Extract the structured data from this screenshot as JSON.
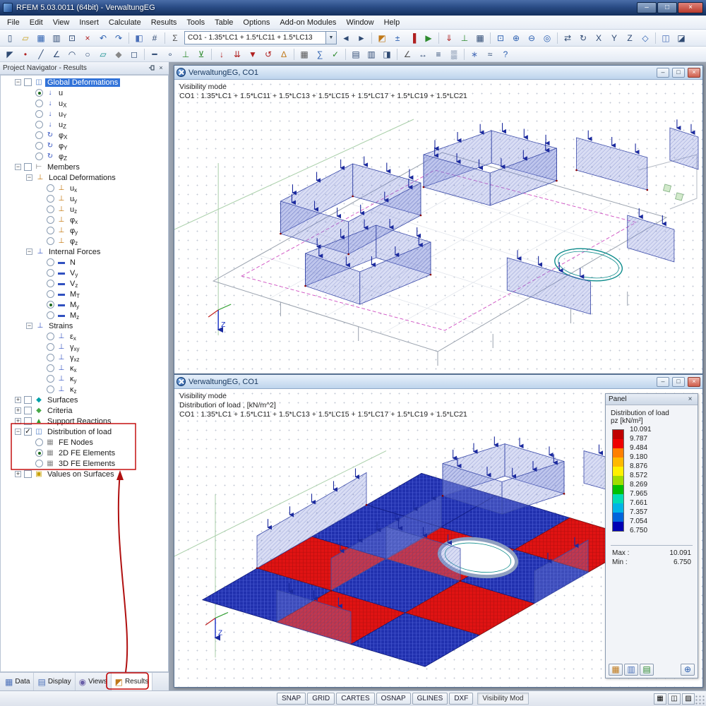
{
  "window": {
    "title": "RFEM 5.03.0011 (64bit) - VerwaltungEG"
  },
  "window_controls": {
    "min": "–",
    "max": "□",
    "close": "×"
  },
  "glyphs": {
    "check": "✓",
    "expander_open": "−",
    "expander_closed": "+",
    "combo_arrow": "▼",
    "z_axis": "Z"
  },
  "menu": [
    "File",
    "Edit",
    "View",
    "Insert",
    "Calculate",
    "Results",
    "Tools",
    "Table",
    "Options",
    "Add-on Modules",
    "Window",
    "Help"
  ],
  "toolbar_main": {
    "left_icons": [
      {
        "n": "new-file",
        "g": "▯"
      },
      {
        "n": "open-file",
        "g": "▱",
        "c": "#c8a020"
      },
      {
        "n": "save",
        "g": "▦",
        "c": "#2b5fb0"
      },
      {
        "n": "print",
        "g": "▥"
      },
      {
        "n": "copy",
        "g": "⊡"
      },
      {
        "n": "delete",
        "g": "×",
        "c": "#b02020"
      },
      {
        "n": "undo",
        "g": "↶",
        "c": "#2b5fb0"
      },
      {
        "n": "redo",
        "g": "↷",
        "c": "#2b5fb0"
      },
      {
        "sep": true
      },
      {
        "n": "render-model",
        "g": "◧",
        "c": "#4a6fb8"
      },
      {
        "n": "show-numbering",
        "g": "#"
      },
      {
        "sep": true
      },
      {
        "n": "load-case-list",
        "g": "Σ",
        "c": "#555"
      }
    ],
    "combo_value": "CO1 - 1.35*LC1 + 1.5*LC11 + 1.5*LC13",
    "right_icons": [
      {
        "n": "previous-load-case",
        "g": "◄"
      },
      {
        "n": "next-load-case",
        "g": "►"
      },
      {
        "sep": true
      },
      {
        "n": "show-results",
        "g": "◩",
        "c": "#c07818"
      },
      {
        "n": "show-result-values",
        "g": "±",
        "c": "#2b5fb0"
      },
      {
        "n": "result-panel-toggle",
        "g": "▐",
        "c": "#b02020"
      },
      {
        "n": "animation",
        "g": "▶",
        "c": "#2e8b2e"
      },
      {
        "sep": true
      },
      {
        "n": "show-loads",
        "g": "⇓",
        "c": "#b02020"
      },
      {
        "n": "show-supports",
        "g": "⊥",
        "c": "#2e8b2e"
      },
      {
        "n": "show-fe-mesh",
        "g": "▦"
      },
      {
        "sep": true
      },
      {
        "n": "zoom-window",
        "g": "⊡",
        "c": "#2b5fb0"
      },
      {
        "n": "zoom-in",
        "g": "⊕",
        "c": "#2b5fb0"
      },
      {
        "n": "zoom-out",
        "g": "⊖",
        "c": "#2b5fb0"
      },
      {
        "n": "zoom-all",
        "g": "◎",
        "c": "#2b5fb0"
      },
      {
        "sep": true
      },
      {
        "n": "pan-view",
        "g": "⇄"
      },
      {
        "n": "rotate-view",
        "g": "↻"
      },
      {
        "n": "view-x",
        "g": "X"
      },
      {
        "n": "view-y",
        "g": "Y"
      },
      {
        "n": "view-z",
        "g": "Z"
      },
      {
        "n": "isometric-view",
        "g": "◇",
        "c": "#2b5fb0"
      },
      {
        "sep": true
      },
      {
        "n": "visibility-mode",
        "g": "◫",
        "c": "#4a6fb8"
      },
      {
        "n": "clipping-plane",
        "g": "◪"
      }
    ]
  },
  "toolbar_edit": {
    "icons": [
      {
        "n": "edit-pointer",
        "g": "◤"
      },
      {
        "n": "insert-node",
        "g": "•",
        "c": "#b02020"
      },
      {
        "n": "insert-line",
        "g": "╱"
      },
      {
        "n": "insert-polyline",
        "g": "∠"
      },
      {
        "n": "insert-arc",
        "g": "◠"
      },
      {
        "n": "insert-circle",
        "g": "○"
      },
      {
        "n": "insert-surface",
        "g": "▱",
        "c": "#0a8a8a"
      },
      {
        "n": "insert-solid",
        "g": "◆",
        "c": "#888888"
      },
      {
        "n": "insert-opening",
        "g": "◻"
      },
      {
        "sep": true
      },
      {
        "n": "insert-member",
        "g": "━"
      },
      {
        "n": "member-hinge",
        "g": "∘"
      },
      {
        "n": "nodal-support",
        "g": "⊥",
        "c": "#2e8b2e"
      },
      {
        "n": "line-support",
        "g": "⊻",
        "c": "#2e8b2e"
      },
      {
        "sep": true
      },
      {
        "n": "nodal-load",
        "g": "↓",
        "c": "#b02020"
      },
      {
        "n": "line-load",
        "g": "⇊",
        "c": "#b02020"
      },
      {
        "n": "surface-load",
        "g": "▼",
        "c": "#b02020"
      },
      {
        "n": "moment-load",
        "g": "↺",
        "c": "#b02020"
      },
      {
        "n": "temperature-load",
        "g": "∆",
        "c": "#c07818"
      },
      {
        "sep": true
      },
      {
        "n": "generate-mesh",
        "g": "▦",
        "c": "#555555"
      },
      {
        "n": "calculate-all",
        "g": "∑",
        "c": "#2b5fb0"
      },
      {
        "n": "check-model",
        "g": "✓",
        "c": "#2e8b2e"
      },
      {
        "sep": true
      },
      {
        "n": "result-tables",
        "g": "▤"
      },
      {
        "n": "printout-report",
        "g": "▥"
      },
      {
        "n": "panel-options",
        "g": "◨"
      },
      {
        "sep": true
      },
      {
        "n": "measure",
        "g": "∠",
        "c": "#555555"
      },
      {
        "n": "dimension",
        "g": "↔"
      },
      {
        "n": "layers",
        "g": "≡"
      },
      {
        "n": "background-grid",
        "g": "▒"
      },
      {
        "sep": true
      },
      {
        "n": "add-on-modules",
        "g": "∗",
        "c": "#4a6fb8"
      },
      {
        "n": "settings",
        "g": "≈"
      },
      {
        "n": "help",
        "g": "?",
        "c": "#2b5fb0"
      }
    ]
  },
  "navigator": {
    "title": "Project Navigator - Results",
    "tabs": [
      {
        "label": "Data",
        "icon": "data-tab-icon",
        "g": "▦",
        "c": "#4a6fb8"
      },
      {
        "label": "Display",
        "icon": "display-tab-icon",
        "g": "▤",
        "c": "#4a6fb8"
      },
      {
        "label": "Views",
        "icon": "views-tab-icon",
        "g": "◉",
        "c": "#6a5fa8"
      },
      {
        "label": "Results",
        "icon": "results-tab-icon",
        "g": "◩",
        "c": "#c07818",
        "active": true
      }
    ],
    "tree": [
      {
        "label": "Global Deformations",
        "level": 0,
        "exp": "minus",
        "ctrl": "check",
        "checked": false,
        "icon": "global-deformations",
        "g": "◫",
        "c": "#4a7ac8",
        "selected": true
      },
      {
        "label": "u",
        "level": 1,
        "ctrl": "radio",
        "checked": true,
        "icon": "deformation-u",
        "g": "↓",
        "c": "#3050c0"
      },
      {
        "label": "u",
        "sub": "X",
        "level": 1,
        "ctrl": "radio",
        "checked": false,
        "icon": "deformation-ux",
        "g": "↓",
        "c": "#3050c0"
      },
      {
        "label": "u",
        "sub": "Y",
        "level": 1,
        "ctrl": "radio",
        "checked": false,
        "icon": "deformation-uy",
        "g": "↓",
        "c": "#3050c0"
      },
      {
        "label": "u",
        "sub": "Z",
        "level": 1,
        "ctrl": "radio",
        "checked": false,
        "icon": "deformation-uz",
        "g": "↓",
        "c": "#3050c0"
      },
      {
        "label": "φ",
        "sub": "X",
        "level": 1,
        "ctrl": "radio",
        "checked": false,
        "icon": "rotation-phix",
        "g": "↻",
        "c": "#3050c0"
      },
      {
        "label": "φ",
        "sub": "Y",
        "level": 1,
        "ctrl": "radio",
        "checked": false,
        "icon": "rotation-phiy",
        "g": "↻",
        "c": "#3050c0"
      },
      {
        "label": "φ",
        "sub": "Z",
        "level": 1,
        "ctrl": "radio",
        "checked": false,
        "icon": "rotation-phiz",
        "g": "↻",
        "c": "#3050c0"
      },
      {
        "label": "Members",
        "level": 0,
        "exp": "minus",
        "ctrl": "check",
        "checked": false,
        "icon": "members",
        "g": "⊢",
        "c": "#707070"
      },
      {
        "label": "Local Deformations",
        "level": 1,
        "exp": "minus",
        "icon": "local-deformations",
        "g": "⊥",
        "c": "#c07000"
      },
      {
        "label": "u",
        "sub": "x",
        "level": 2,
        "ctrl": "radio",
        "checked": false,
        "icon": "member-ux",
        "g": "⊥",
        "c": "#c07000"
      },
      {
        "label": "u",
        "sub": "y",
        "level": 2,
        "ctrl": "radio",
        "checked": false,
        "icon": "member-uy",
        "g": "⊥",
        "c": "#c07000"
      },
      {
        "label": "u",
        "sub": "z",
        "level": 2,
        "ctrl": "radio",
        "checked": false,
        "icon": "member-uz",
        "g": "⊥",
        "c": "#c07000"
      },
      {
        "label": "φ",
        "sub": "x",
        "level": 2,
        "ctrl": "radio",
        "checked": false,
        "icon": "member-phix",
        "g": "⊥",
        "c": "#c07000"
      },
      {
        "label": "φ",
        "sub": "y",
        "level": 2,
        "ctrl": "radio",
        "checked": false,
        "icon": "member-phiy",
        "g": "⊥",
        "c": "#c07000"
      },
      {
        "label": "φ",
        "sub": "z",
        "level": 2,
        "ctrl": "radio",
        "checked": false,
        "icon": "member-phiz",
        "g": "⊥",
        "c": "#c07000"
      },
      {
        "label": "Internal Forces",
        "level": 1,
        "exp": "minus",
        "icon": "internal-forces",
        "g": "⊥",
        "c": "#3050c0"
      },
      {
        "label": "N",
        "level": 2,
        "ctrl": "radio",
        "checked": false,
        "icon": "force-n",
        "g": "▬",
        "c": "#3050c0"
      },
      {
        "label": "V",
        "sub": "y",
        "level": 2,
        "ctrl": "radio",
        "checked": false,
        "icon": "force-vy",
        "g": "▬",
        "c": "#3050c0"
      },
      {
        "label": "V",
        "sub": "z",
        "level": 2,
        "ctrl": "radio",
        "checked": false,
        "icon": "force-vz",
        "g": "▬",
        "c": "#3050c0"
      },
      {
        "label": "M",
        "sub": "T",
        "level": 2,
        "ctrl": "radio",
        "checked": false,
        "icon": "moment-mt",
        "g": "▬",
        "c": "#3050c0"
      },
      {
        "label": "M",
        "sub": "y",
        "level": 2,
        "ctrl": "radio",
        "checked": true,
        "icon": "moment-my",
        "g": "▬",
        "c": "#3050c0"
      },
      {
        "label": "M",
        "sub": "z",
        "level": 2,
        "ctrl": "radio",
        "checked": false,
        "icon": "moment-mz",
        "g": "▬",
        "c": "#3050c0"
      },
      {
        "label": "Strains",
        "level": 1,
        "exp": "minus",
        "icon": "strains",
        "g": "⊥",
        "c": "#3050c0"
      },
      {
        "label": "ε",
        "sub": "x",
        "level": 2,
        "ctrl": "radio",
        "checked": false,
        "icon": "strain-ex",
        "g": "⊥",
        "c": "#3050c0"
      },
      {
        "label": "γ",
        "sub": "xy",
        "level": 2,
        "ctrl": "radio",
        "checked": false,
        "icon": "strain-gxy",
        "g": "⊥",
        "c": "#3050c0"
      },
      {
        "label": "γ",
        "sub": "xz",
        "level": 2,
        "ctrl": "radio",
        "checked": false,
        "icon": "strain-gxz",
        "g": "⊥",
        "c": "#3050c0"
      },
      {
        "label": "κ",
        "sub": "x",
        "level": 2,
        "ctrl": "radio",
        "checked": false,
        "icon": "strain-kx",
        "g": "⊥",
        "c": "#3050c0"
      },
      {
        "label": "κ",
        "sub": "y",
        "level": 2,
        "ctrl": "radio",
        "checked": false,
        "icon": "strain-ky",
        "g": "⊥",
        "c": "#3050c0"
      },
      {
        "label": "κ",
        "sub": "z",
        "level": 2,
        "ctrl": "radio",
        "checked": false,
        "icon": "strain-kz",
        "g": "⊥",
        "c": "#3050c0"
      },
      {
        "label": "Surfaces",
        "level": 0,
        "exp": "plus",
        "ctrl": "check",
        "checked": false,
        "icon": "surfaces",
        "g": "◆",
        "c": "#00a0a8"
      },
      {
        "label": "Criteria",
        "level": 0,
        "exp": "plus",
        "ctrl": "check",
        "checked": false,
        "icon": "criteria",
        "g": "◆",
        "c": "#46a846"
      },
      {
        "label": "Support Reactions",
        "level": 0,
        "exp": "plus",
        "ctrl": "check",
        "checked": false,
        "icon": "support-reactions",
        "g": "▲",
        "c": "#2e9e2e"
      },
      {
        "label": "Distribution of load",
        "level": 0,
        "exp": "minus",
        "ctrl": "check",
        "checked": true,
        "icon": "distribution-of-load",
        "g": "◫",
        "c": "#4a7ac8"
      },
      {
        "label": "FE Nodes",
        "level": 1,
        "ctrl": "radio",
        "checked": false,
        "icon": "fe-nodes",
        "g": "▦",
        "c": "#888888"
      },
      {
        "label": "2D FE Elements",
        "level": 1,
        "ctrl": "radio",
        "checked": true,
        "icon": "fe-elements-2d",
        "g": "▦",
        "c": "#888888"
      },
      {
        "label": "3D FE Elements",
        "level": 1,
        "ctrl": "radio",
        "checked": false,
        "icon": "fe-elements-3d",
        "g": "▦",
        "c": "#888888"
      },
      {
        "label": "Values on Surfaces",
        "level": 0,
        "exp": "plus",
        "ctrl": "check",
        "checked": false,
        "icon": "values-on-surfaces",
        "g": "▣",
        "c": "#c8a000"
      }
    ]
  },
  "viewport_top": {
    "title": "VerwaltungEG, CO1",
    "mode_line": "Visibility mode",
    "combo_line": "CO1 : 1.35*LC1 + 1.5*LC11 + 1.5*LC13 + 1.5*LC15 + 1.5*LC17 + 1.5*LC19 + 1.5*LC21"
  },
  "viewport_bottom": {
    "title": "VerwaltungEG, CO1",
    "mode_line": "Visibility mode",
    "result_line": "Distribution of load , [kN/m^2]",
    "combo_line": "CO1 : 1.35*LC1 + 1.5*LC11 + 1.5*LC13 + 1.5*LC15 + 1.5*LC17 + 1.5*LC19 + 1.5*LC21"
  },
  "panel": {
    "title": "Panel",
    "result_name": "Distribution of load",
    "unit_line": "pz [kN/m²]",
    "scale_values": [
      "10.091",
      "9.787",
      "9.484",
      "9.180",
      "8.876",
      "8.572",
      "8.269",
      "7.965",
      "7.661",
      "7.357",
      "7.054",
      "6.750"
    ],
    "scale_colors": [
      "#c00000",
      "#ee0000",
      "#ff7f00",
      "#ffb900",
      "#fff000",
      "#9fdd00",
      "#00c000",
      "#00dcb4",
      "#00b4e6",
      "#0064dc",
      "#0000b4"
    ],
    "max_label": "Max :",
    "max_value": "10.091",
    "min_label": "Min :",
    "min_value": "6.750",
    "footer_buttons": [
      {
        "n": "panel-color-scale",
        "g": "▦",
        "c": "#c07818"
      },
      {
        "n": "panel-factors",
        "g": "▥",
        "c": "#4a6fb8"
      },
      {
        "n": "panel-filter",
        "g": "▤",
        "c": "#2e8b2e"
      }
    ],
    "footer_right_button": {
      "n": "panel-zoom",
      "g": "⊕",
      "c": "#2b5fb0"
    }
  },
  "statusbar": {
    "buttons": [
      "SNAP",
      "GRID",
      "CARTES",
      "OSNAP",
      "GLINES",
      "DXF"
    ],
    "mode": "Visibility Mod",
    "right_icons": [
      {
        "n": "status-layers",
        "g": "▦"
      },
      {
        "n": "status-display",
        "g": "◫"
      },
      {
        "n": "status-render",
        "g": "▨"
      }
    ]
  }
}
